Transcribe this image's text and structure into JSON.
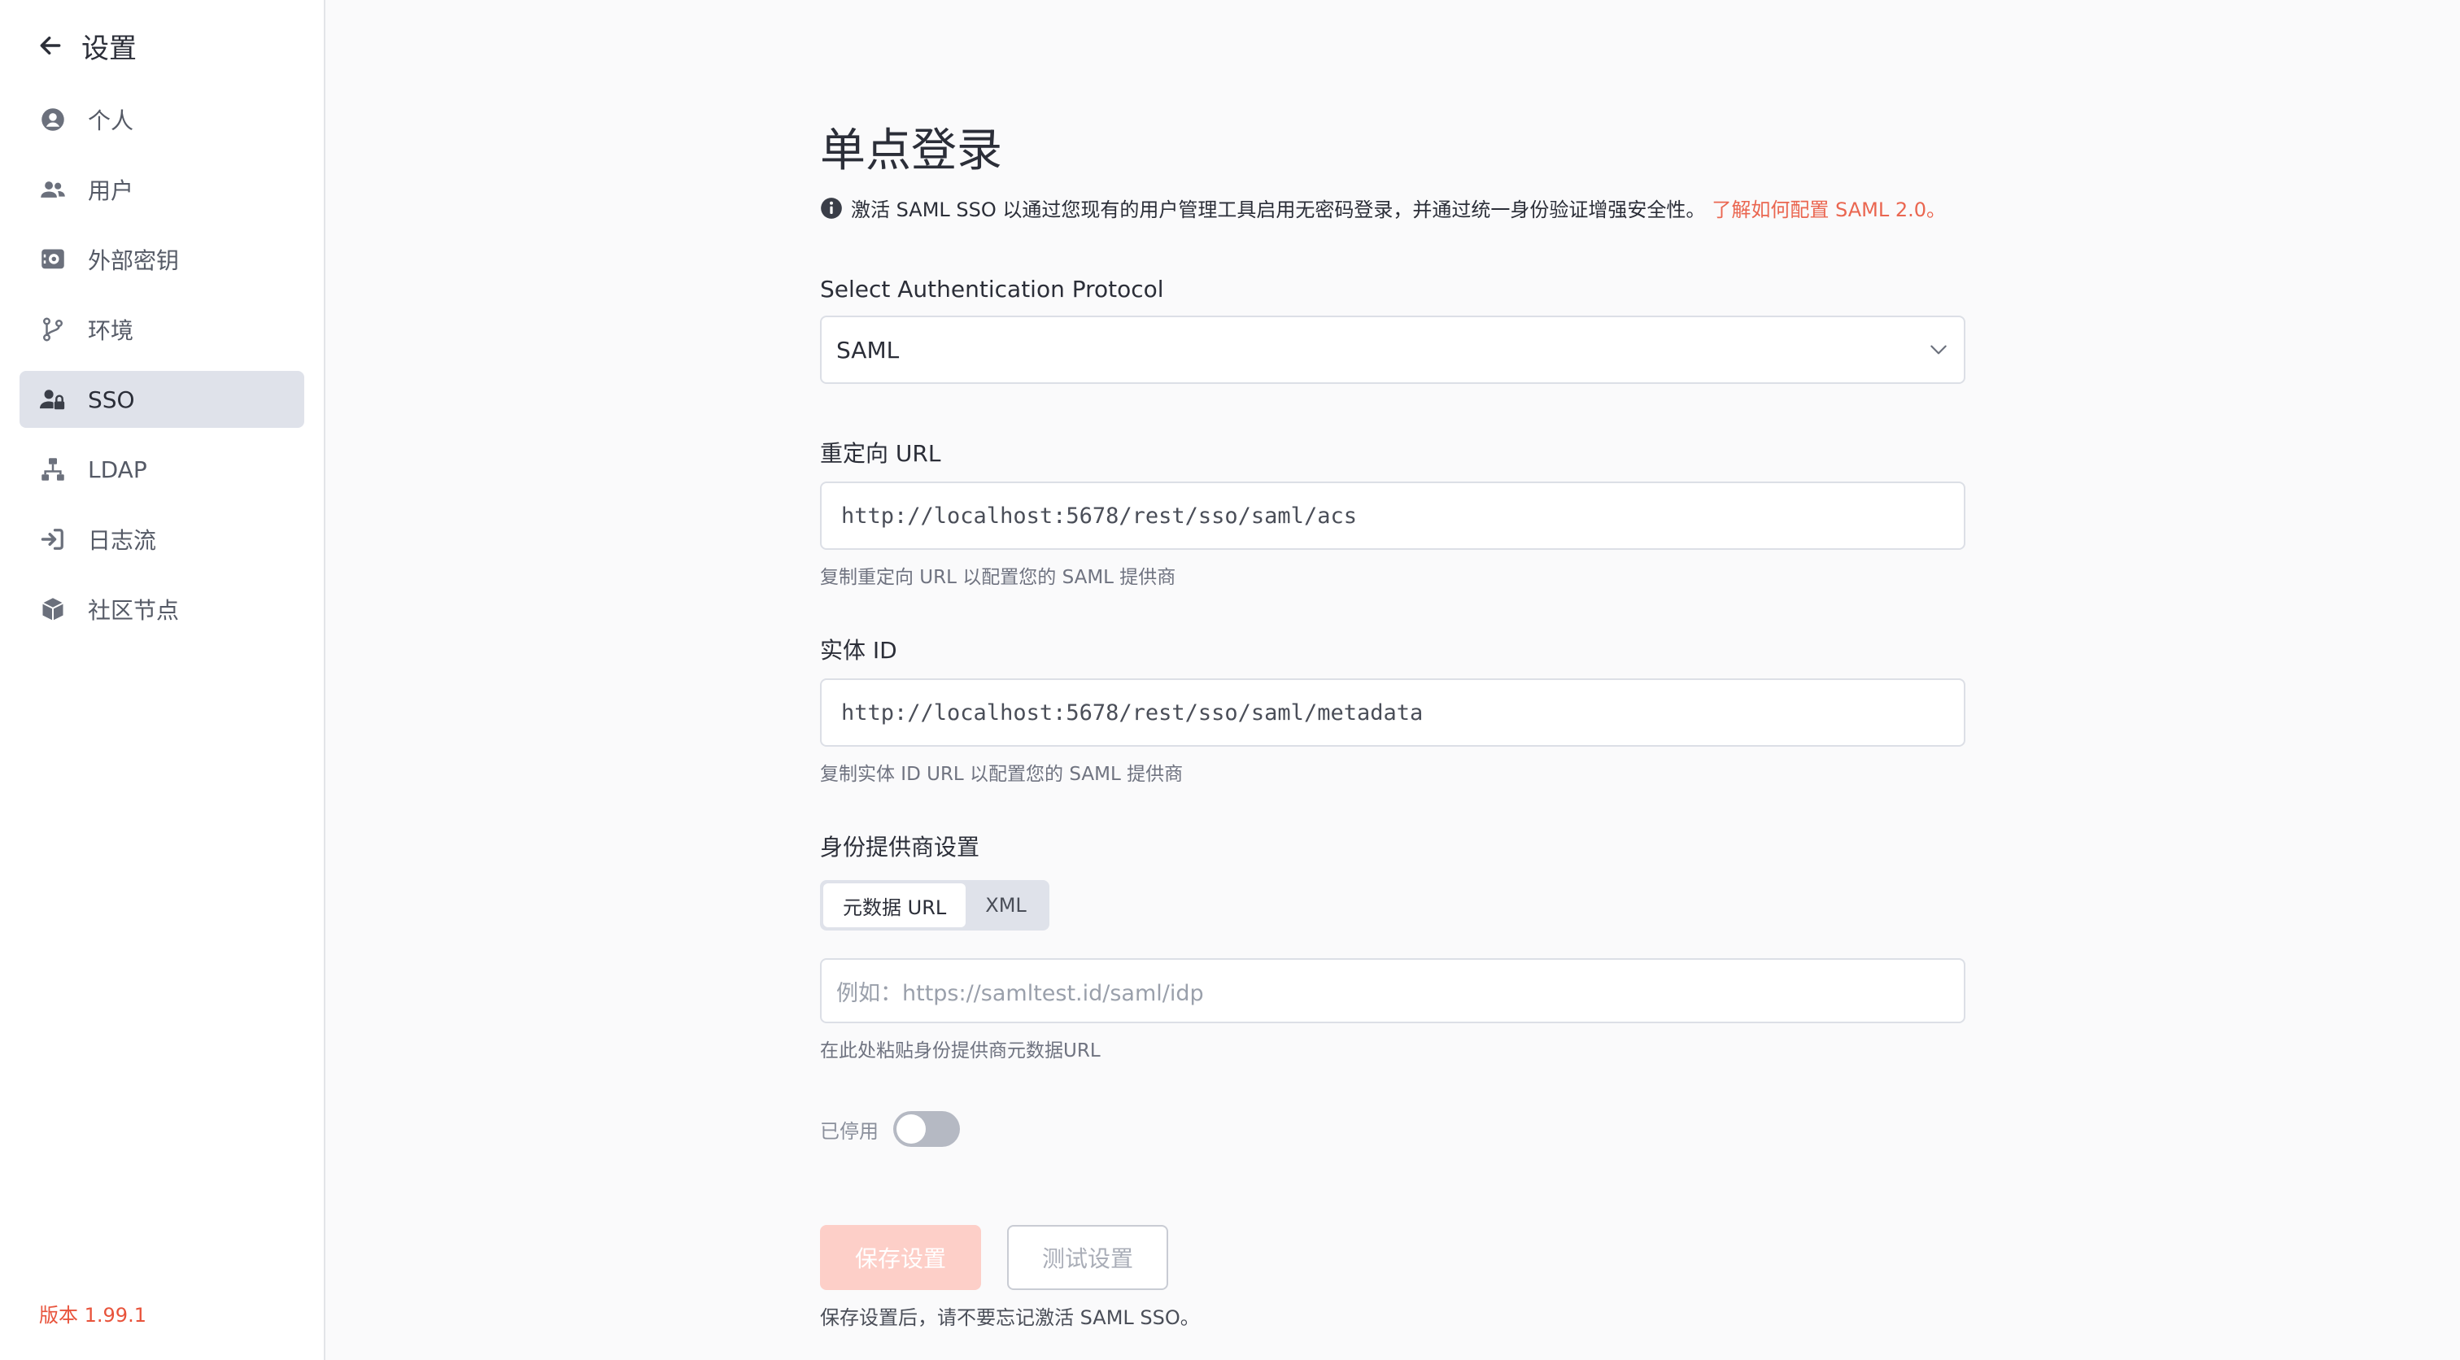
{
  "sidebar": {
    "title": "设置",
    "items": [
      {
        "label": "个人",
        "icon": "user-circle-icon"
      },
      {
        "label": "用户",
        "icon": "users-icon"
      },
      {
        "label": "外部密钥",
        "icon": "vault-icon"
      },
      {
        "label": "环境",
        "icon": "git-branch-icon"
      },
      {
        "label": "SSO",
        "icon": "user-lock-icon",
        "active": true
      },
      {
        "label": "LDAP",
        "icon": "network-icon"
      },
      {
        "label": "日志流",
        "icon": "sign-in-icon"
      },
      {
        "label": "社区节点",
        "icon": "cube-icon"
      }
    ],
    "version": "版本 1.99.1"
  },
  "page": {
    "title": "单点登录",
    "info_text": "激活 SAML SSO 以通过您现有的用户管理工具启用无密码登录，并通过统一身份验证增强安全性。",
    "info_link": "了解如何配置 SAML 2.0。"
  },
  "protocol": {
    "label": "Select Authentication Protocol",
    "value": "SAML"
  },
  "redirect": {
    "label": "重定向 URL",
    "value": "http://localhost:5678/rest/sso/saml/acs",
    "hint": "复制重定向 URL 以配置您的 SAML 提供商"
  },
  "entity": {
    "label": "实体 ID",
    "value": "http://localhost:5678/rest/sso/saml/metadata",
    "hint": "复制实体 ID URL 以配置您的 SAML 提供商"
  },
  "idp": {
    "label": "身份提供商设置",
    "tabs": [
      "元数据 URL",
      "XML"
    ],
    "active_tab": "元数据 URL",
    "placeholder": "例如：https://samltest.id/saml/idp",
    "hint": "在此处粘贴身份提供商元数据URL"
  },
  "status": {
    "label": "已停用",
    "enabled": false
  },
  "actions": {
    "save": "保存设置",
    "test": "测试设置",
    "hint": "保存设置后，请不要忘记激活 SAML SSO。"
  },
  "colors": {
    "accent": "#ea6650",
    "active_nav_bg": "#dfe2ea",
    "primary_disabled": "#fdcfc8"
  }
}
